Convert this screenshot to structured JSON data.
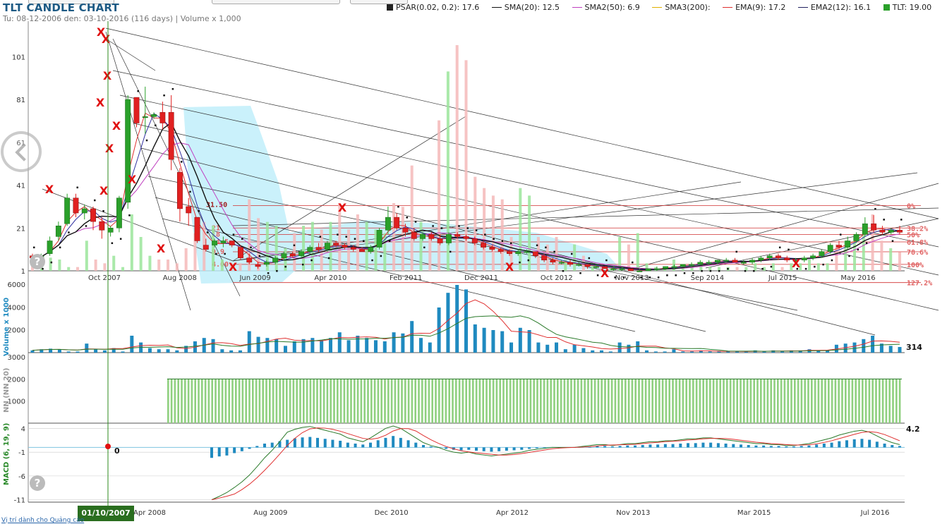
{
  "header": {
    "title": "TLT CANDLE CHART",
    "subtitle": "Tu: 08-12-2006 den: 03-10-2016 (116 days) | Volume x 1,000"
  },
  "legend": [
    {
      "label": "PSAR(0.02, 0.2): 17.6",
      "color": "#222222",
      "kind": "square"
    },
    {
      "label": "SMA(20): 12.5",
      "color": "#111111",
      "kind": "line"
    },
    {
      "label": "SMA2(50): 6.9",
      "color": "#c040c0",
      "kind": "line"
    },
    {
      "label": "SMA3(200):",
      "color": "#e0b000",
      "kind": "line"
    },
    {
      "label": "EMA(9): 17.2",
      "color": "#e03030",
      "kind": "line"
    },
    {
      "label": "EMA2(12): 16.1",
      "color": "#202060",
      "kind": "line"
    },
    {
      "label": "TLT: 19.00",
      "color": "#2aa02a",
      "kind": "square"
    }
  ],
  "colors": {
    "up": "#2aa02a",
    "down": "#e02020",
    "vol_up": "#9be59b",
    "vol_down": "#f5b8b8",
    "vol_bar": "#1f8ac0",
    "cloud": "#bdeefa",
    "cursor": "#2e8b1e",
    "axis_text": "#333333"
  },
  "icons": {
    "left_nav": "chevron-left-circle-icon",
    "help": "help-circle-icon"
  },
  "cursor": {
    "label": "01/10/2007",
    "macd_value": "0"
  },
  "footer": {
    "link_text": "Vị trí dành cho Quảng cáo"
  },
  "chart_data": {
    "type": "candlestick",
    "title": "TLT CANDLE CHART",
    "x_tick_labels_main": [
      "Oct 2007",
      "Aug 2008",
      "Jun 2009",
      "Apr 2010",
      "Feb 2011",
      "Dec 2011",
      "Oct 2012",
      "Nov 2013",
      "Sep 2014",
      "Jul 2015",
      "May 2016"
    ],
    "x_tick_labels_bottom": [
      "Apr 2008",
      "Aug 2009",
      "Dec 2010",
      "Apr 2012",
      "Nov 2013",
      "Mar 2015",
      "Jul 2016"
    ],
    "price_axis": {
      "ticks": [
        1,
        21,
        41,
        61,
        81,
        101
      ],
      "ylim": [
        1,
        111
      ]
    },
    "candles": [
      {
        "o": 8,
        "h": 9,
        "l": 6,
        "c": 7
      },
      {
        "o": 6,
        "h": 9,
        "l": 5,
        "c": 8
      },
      {
        "o": 9,
        "h": 17,
        "l": 8,
        "c": 15
      },
      {
        "o": 17,
        "h": 24,
        "l": 15,
        "c": 22
      },
      {
        "o": 23,
        "h": 37,
        "l": 22,
        "c": 35
      },
      {
        "o": 35,
        "h": 37,
        "l": 26,
        "c": 28
      },
      {
        "o": 28,
        "h": 32,
        "l": 25,
        "c": 30
      },
      {
        "o": 30,
        "h": 31,
        "l": 20,
        "c": 24
      },
      {
        "o": 24,
        "h": 26,
        "l": 16,
        "c": 20
      },
      {
        "o": 19,
        "h": 22,
        "l": 17,
        "c": 21
      },
      {
        "o": 21,
        "h": 36,
        "l": 19,
        "c": 35
      },
      {
        "o": 33,
        "h": 83,
        "l": 30,
        "c": 81
      },
      {
        "o": 82,
        "h": 82,
        "l": 68,
        "c": 70
      },
      {
        "o": 73,
        "h": 87,
        "l": 65,
        "c": 73
      },
      {
        "o": 73,
        "h": 75,
        "l": 72,
        "c": 74
      },
      {
        "o": 75,
        "h": 80,
        "l": 67,
        "c": 70
      },
      {
        "o": 75,
        "h": 83,
        "l": 48,
        "c": 53
      },
      {
        "o": 47,
        "h": 49,
        "l": 24,
        "c": 30
      },
      {
        "o": 31,
        "h": 35,
        "l": 22,
        "c": 28
      },
      {
        "o": 26,
        "h": 26,
        "l": 14,
        "c": 15
      },
      {
        "o": 13,
        "h": 16,
        "l": 10,
        "c": 11
      },
      {
        "o": 13,
        "h": 16,
        "l": 12,
        "c": 15
      },
      {
        "o": 14,
        "h": 17,
        "l": 12,
        "c": 15
      },
      {
        "o": 15,
        "h": 15,
        "l": 12,
        "c": 13
      },
      {
        "o": 12,
        "h": 13,
        "l": 6,
        "c": 7
      },
      {
        "o": 7,
        "h": 9,
        "l": 4,
        "c": 5
      },
      {
        "o": 4,
        "h": 5,
        "l": 2,
        "c": 3
      },
      {
        "o": 4,
        "h": 6,
        "l": 3,
        "c": 5
      },
      {
        "o": 5,
        "h": 8,
        "l": 4,
        "c": 7
      },
      {
        "o": 7,
        "h": 10,
        "l": 6,
        "c": 9
      },
      {
        "o": 9,
        "h": 10,
        "l": 7,
        "c": 8
      },
      {
        "o": 8,
        "h": 11,
        "l": 7,
        "c": 10
      },
      {
        "o": 10,
        "h": 13,
        "l": 9,
        "c": 12
      },
      {
        "o": 12,
        "h": 14,
        "l": 10,
        "c": 11
      },
      {
        "o": 11,
        "h": 15,
        "l": 10,
        "c": 14
      },
      {
        "o": 14,
        "h": 15,
        "l": 12,
        "c": 13
      },
      {
        "o": 13,
        "h": 14,
        "l": 11,
        "c": 12
      },
      {
        "o": 12,
        "h": 13,
        "l": 10,
        "c": 11
      },
      {
        "o": 11,
        "h": 12,
        "l": 10,
        "c": 10
      },
      {
        "o": 10,
        "h": 13,
        "l": 9,
        "c": 12
      },
      {
        "o": 12,
        "h": 21,
        "l": 11,
        "c": 20
      },
      {
        "o": 20,
        "h": 31,
        "l": 18,
        "c": 26
      },
      {
        "o": 26,
        "h": 28,
        "l": 20,
        "c": 21
      },
      {
        "o": 21,
        "h": 23,
        "l": 17,
        "c": 19
      },
      {
        "o": 19,
        "h": 21,
        "l": 15,
        "c": 16
      },
      {
        "o": 16,
        "h": 19,
        "l": 15,
        "c": 18
      },
      {
        "o": 18,
        "h": 19,
        "l": 15,
        "c": 16
      },
      {
        "o": 16,
        "h": 18,
        "l": 13,
        "c": 14
      },
      {
        "o": 14,
        "h": 19,
        "l": 13,
        "c": 18
      },
      {
        "o": 18,
        "h": 19,
        "l": 16,
        "c": 17
      },
      {
        "o": 17,
        "h": 18,
        "l": 15,
        "c": 16
      },
      {
        "o": 16,
        "h": 17,
        "l": 13,
        "c": 14
      },
      {
        "o": 14,
        "h": 15,
        "l": 11,
        "c": 12
      },
      {
        "o": 12,
        "h": 13,
        "l": 10,
        "c": 11
      },
      {
        "o": 11,
        "h": 12,
        "l": 9,
        "c": 10
      },
      {
        "o": 10,
        "h": 11,
        "l": 8,
        "c": 9
      },
      {
        "o": 9,
        "h": 11,
        "l": 8,
        "c": 10
      },
      {
        "o": 10,
        "h": 11,
        "l": 9,
        "c": 10
      },
      {
        "o": 10,
        "h": 10,
        "l": 7,
        "c": 8
      },
      {
        "o": 8,
        "h": 9,
        "l": 5,
        "c": 6
      },
      {
        "o": 6,
        "h": 7,
        "l": 4,
        "c": 5
      },
      {
        "o": 5,
        "h": 6,
        "l": 4,
        "c": 5
      },
      {
        "o": 5,
        "h": 6,
        "l": 3,
        "c": 4
      },
      {
        "o": 4,
        "h": 5,
        "l": 3,
        "c": 4
      },
      {
        "o": 4,
        "h": 4,
        "l": 2,
        "c": 3
      },
      {
        "o": 3,
        "h": 4,
        "l": 2,
        "c": 3
      },
      {
        "o": 3,
        "h": 3,
        "l": 2,
        "c": 2
      },
      {
        "o": 2,
        "h": 3,
        "l": 1,
        "c": 2
      },
      {
        "o": 2,
        "h": 3,
        "l": 1,
        "c": 2
      },
      {
        "o": 2,
        "h": 2,
        "l": 1,
        "c": 1
      },
      {
        "o": 1,
        "h": 2,
        "l": 1,
        "c": 1
      },
      {
        "o": 1,
        "h": 2,
        "l": 1,
        "c": 2
      },
      {
        "o": 2,
        "h": 3,
        "l": 1,
        "c": 2
      },
      {
        "o": 2,
        "h": 3,
        "l": 2,
        "c": 3
      },
      {
        "o": 3,
        "h": 4,
        "l": 2,
        "c": 3
      },
      {
        "o": 3,
        "h": 4,
        "l": 3,
        "c": 4
      },
      {
        "o": 4,
        "h": 5,
        "l": 3,
        "c": 4
      },
      {
        "o": 4,
        "h": 6,
        "l": 4,
        "c": 5
      },
      {
        "o": 5,
        "h": 6,
        "l": 4,
        "c": 5
      },
      {
        "o": 5,
        "h": 6,
        "l": 4,
        "c": 6
      },
      {
        "o": 6,
        "h": 7,
        "l": 5,
        "c": 6
      },
      {
        "o": 6,
        "h": 7,
        "l": 5,
        "c": 5
      },
      {
        "o": 5,
        "h": 6,
        "l": 4,
        "c": 5
      },
      {
        "o": 5,
        "h": 7,
        "l": 4,
        "c": 6
      },
      {
        "o": 6,
        "h": 8,
        "l": 5,
        "c": 7
      },
      {
        "o": 7,
        "h": 9,
        "l": 6,
        "c": 8
      },
      {
        "o": 8,
        "h": 9,
        "l": 6,
        "c": 7
      },
      {
        "o": 7,
        "h": 8,
        "l": 5,
        "c": 6
      },
      {
        "o": 6,
        "h": 7,
        "l": 5,
        "c": 6
      },
      {
        "o": 6,
        "h": 8,
        "l": 5,
        "c": 7
      },
      {
        "o": 7,
        "h": 9,
        "l": 6,
        "c": 8
      },
      {
        "o": 8,
        "h": 11,
        "l": 7,
        "c": 10
      },
      {
        "o": 10,
        "h": 14,
        "l": 9,
        "c": 13
      },
      {
        "o": 13,
        "h": 15,
        "l": 11,
        "c": 12
      },
      {
        "o": 12,
        "h": 17,
        "l": 11,
        "c": 15
      },
      {
        "o": 15,
        "h": 19,
        "l": 14,
        "c": 18
      },
      {
        "o": 18,
        "h": 26,
        "l": 17,
        "c": 23
      },
      {
        "o": 23,
        "h": 27,
        "l": 19,
        "c": 20
      },
      {
        "o": 20,
        "h": 22,
        "l": 18,
        "c": 19
      },
      {
        "o": 19,
        "h": 21,
        "l": 18,
        "c": 20
      },
      {
        "o": 20,
        "h": 22,
        "l": 18,
        "c": 19
      }
    ],
    "volume_axis": {
      "label": "Volume x 1000",
      "ticks": [
        "2000",
        "4000",
        "6000"
      ],
      "last_value": "314"
    },
    "volume": [
      200,
      300,
      350,
      300,
      100,
      100,
      800,
      300,
      200,
      400,
      100,
      1500,
      900,
      400,
      300,
      300,
      200,
      600,
      1000,
      1300,
      1200,
      300,
      200,
      200,
      1900,
      1400,
      1300,
      1200,
      600,
      1000,
      1200,
      1300,
      1100,
      1300,
      1800,
      1100,
      1500,
      1300,
      1100,
      1000,
      1800,
      1700,
      2800,
      1300,
      900,
      4000,
      5300,
      6000,
      5600,
      2500,
      2200,
      2000,
      1900,
      900,
      2200,
      2000,
      900,
      700,
      900,
      300,
      700,
      400,
      200,
      200,
      100,
      900,
      700,
      1000,
      200,
      100,
      100,
      300,
      100,
      100,
      200,
      100,
      100,
      100,
      100,
      100,
      200,
      100,
      200,
      100,
      200,
      200,
      300,
      200,
      200,
      700,
      800,
      900,
      1200,
      1500,
      800,
      600,
      500
    ],
    "nn_axis": {
      "label": "NN (NN 20)",
      "ticks": [
        "1000",
        "2000",
        "3000"
      ],
      "value": 2000
    },
    "macd_axis": {
      "label": "MACD (6, 19, 9)",
      "ticks": [
        "4",
        "-1",
        "-6",
        "-11"
      ],
      "last_value": "4.2"
    },
    "macd_hist": [
      -2.2,
      -1.9,
      -1.7,
      -1.2,
      -0.8,
      -0.3,
      0.3,
      0.8,
      1.0,
      1.3,
      1.6,
      1.9,
      2.1,
      2.2,
      2.0,
      1.8,
      1.6,
      1.4,
      1.0,
      0.8,
      0.6,
      1.0,
      1.5,
      2.0,
      2.4,
      2.0,
      1.5,
      1.0,
      0.5,
      0.2,
      0.0,
      -0.3,
      -0.5,
      -0.6,
      -0.5,
      -0.7,
      -0.8,
      -0.9,
      -0.8,
      -0.7,
      -0.6,
      -0.5,
      -0.3,
      -0.2,
      -0.1,
      0,
      0,
      0,
      0,
      0.1,
      0.2,
      0.3,
      0.3,
      0.2,
      0.3,
      0.4,
      0.4,
      0.5,
      0.6,
      0.6,
      0.7,
      0.7,
      0.8,
      0.9,
      0.9,
      1.0,
      1.0,
      0.9,
      0.8,
      0.7,
      0.6,
      0.5,
      0.4,
      0.4,
      0.3,
      0.3,
      0.2,
      0.2,
      0.3,
      0.4,
      0.6,
      0.8,
      1.0,
      1.3,
      1.5,
      1.7,
      1.8,
      1.6,
      1.2,
      0.8,
      0.5,
      0.3
    ],
    "fib_levels": [
      {
        "label": "0%",
        "price": 31.5
      },
      {
        "label": "38.2%",
        "price": 21
      },
      {
        "label": "50%",
        "price": 18
      },
      {
        "label": "61.8%",
        "price": 14.5
      },
      {
        "label": "78.6%",
        "price": 9.9
      },
      {
        "label": "100%",
        "price": 4.0
      },
      {
        "label": "127.2%",
        "price": -4.5
      }
    ],
    "price_annotations": [
      "31.50",
      "21",
      "18",
      "14.5",
      "9.9",
      "4.00"
    ]
  }
}
